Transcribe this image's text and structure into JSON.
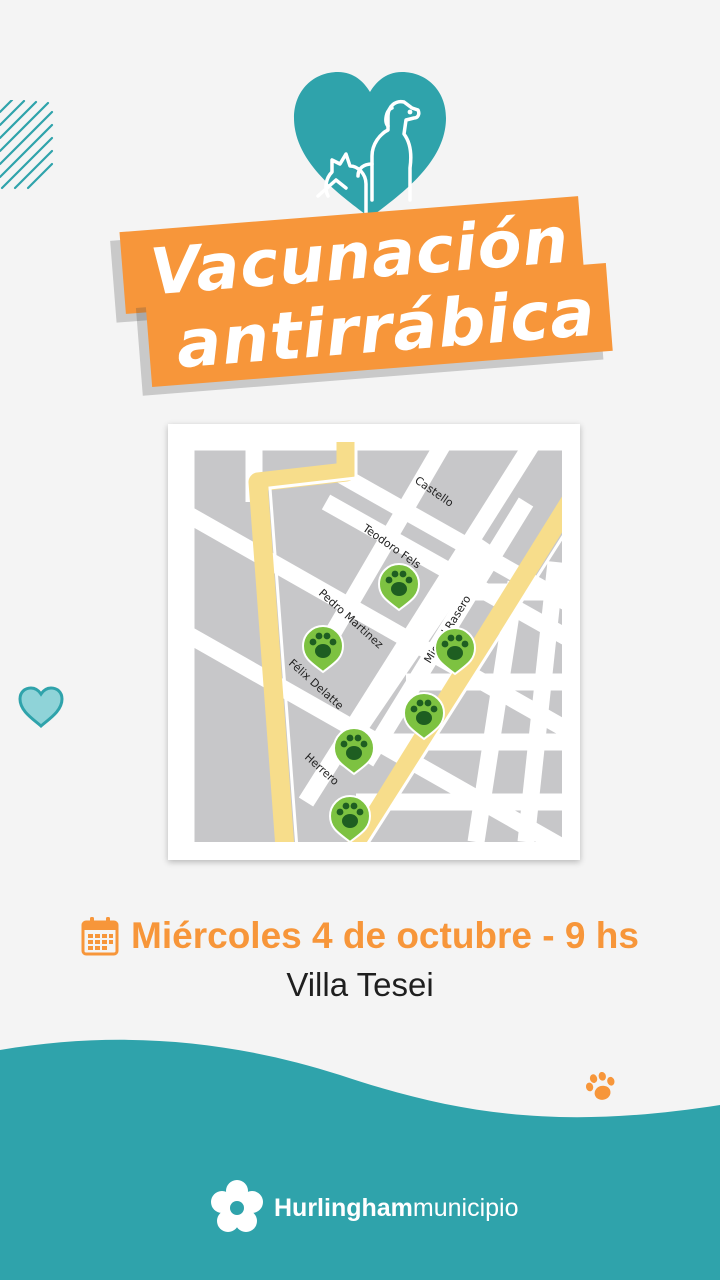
{
  "title": {
    "line1": "Vacunación",
    "line2": "antirrábica"
  },
  "map": {
    "streets": {
      "castello": "Castello",
      "teodoro_fels": "Teodoro Fels",
      "pedro_martinez": "Pedro Martinez",
      "miguel_rasero": "Miguel Rasero",
      "felix_delatte": "Félix Delatte",
      "herrero": "Herrero"
    },
    "marker_icon": "paw-pin-icon"
  },
  "event": {
    "date_time": "Miércoles 4 de octubre - 9 hs",
    "place": "Villa Tesei",
    "calendar_icon": "calendar-icon"
  },
  "footer": {
    "brand_strong": "Hurlingham",
    "brand_light": "municipio",
    "logo_icon": "flower-logo-icon"
  },
  "colors": {
    "teal": "#2fa3ab",
    "orange": "#f7963a",
    "marker_green": "#7dc241",
    "paw_dark": "#1e5e21",
    "road_yellow": "#f7dd8b",
    "block_gray": "#c7c7c9"
  }
}
